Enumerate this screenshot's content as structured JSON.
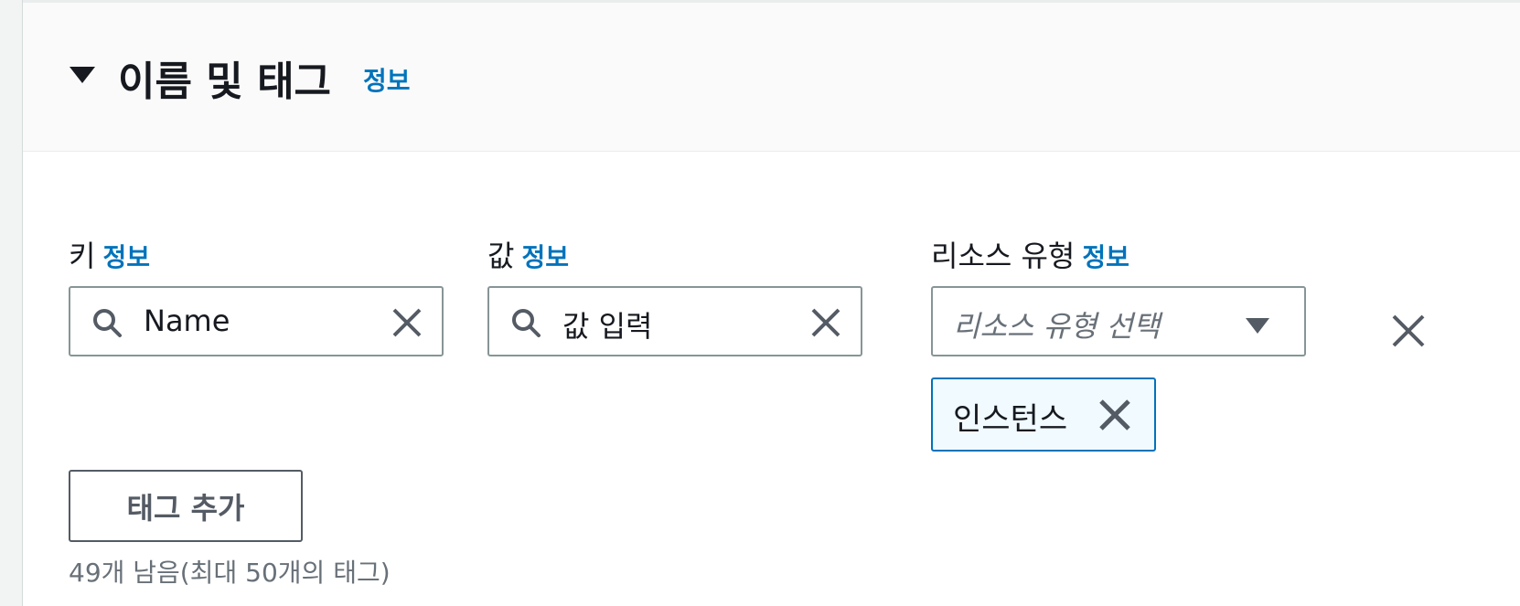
{
  "section": {
    "title": "이름 및 태그",
    "info": "정보"
  },
  "fields": {
    "key": {
      "label": "키",
      "info": "정보",
      "value": "Name"
    },
    "value": {
      "label": "값",
      "info": "정보",
      "value": "값 입력"
    },
    "resource_type": {
      "label": "리소스 유형",
      "info": "정보",
      "placeholder": "리소스 유형 선택"
    }
  },
  "selected_tokens": [
    {
      "label": "인스턴스"
    }
  ],
  "add_tag_button": {
    "label": "태그 추가"
  },
  "hint": "49개 남음(최대 50개의 태그)",
  "icons": {
    "expand": "caret-down-icon",
    "search": "search-icon",
    "clear": "close-icon",
    "dropdown": "caret-down-icon",
    "remove": "close-icon"
  },
  "colors": {
    "link": "#0073bb",
    "text": "#16191f",
    "border": "#879596",
    "token_bg": "#f1faff",
    "token_border": "#0073bb",
    "muted": "#687078"
  }
}
